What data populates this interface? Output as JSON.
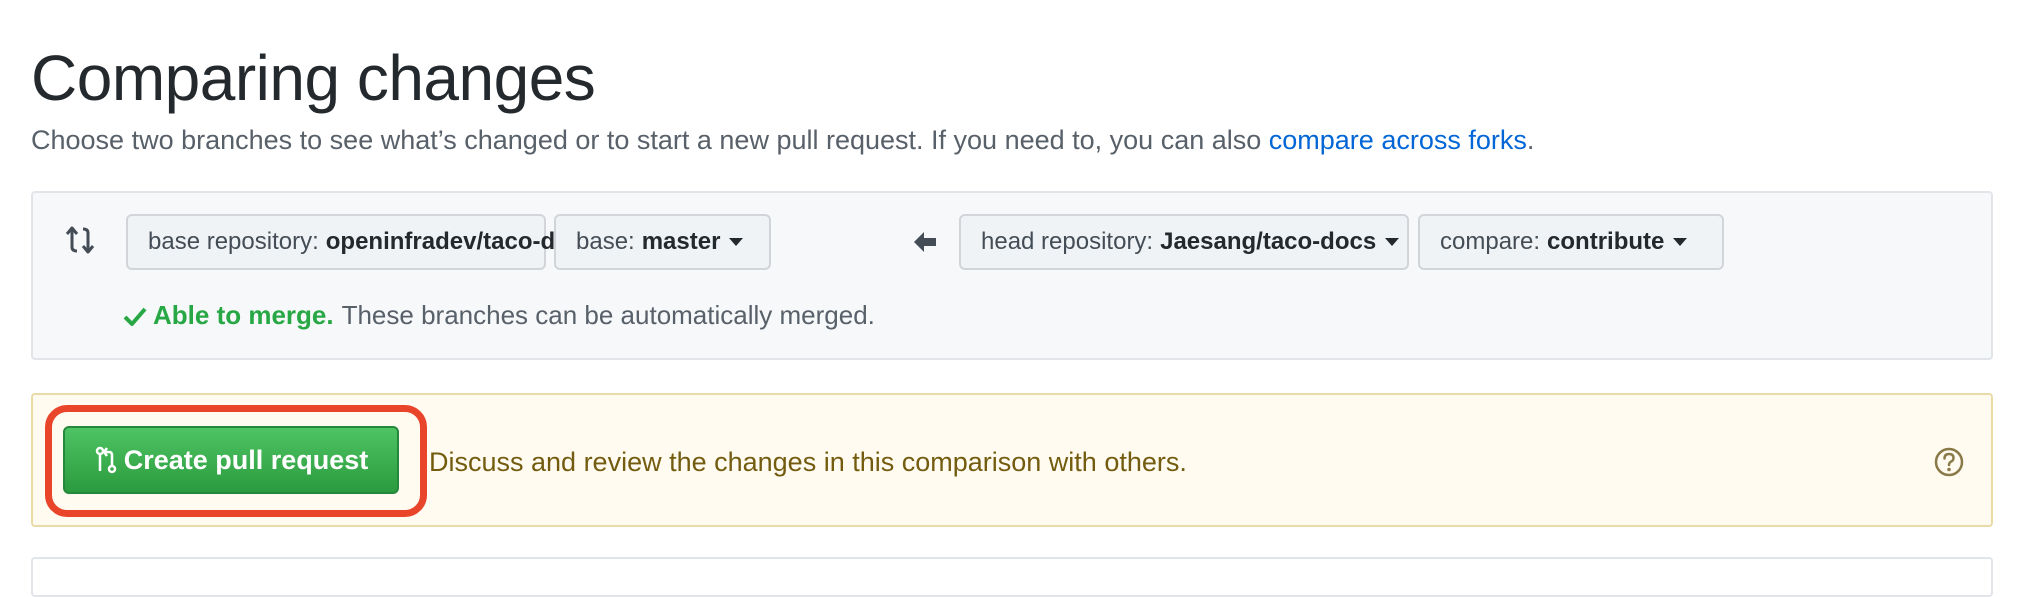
{
  "header": {
    "title": "Comparing changes",
    "subtitle": "Choose two branches to see what’s changed or to start a new pull request. If you need to, you can also ",
    "subtitle_link": "compare across forks",
    "subtitle_end": "."
  },
  "range": {
    "base_repo": {
      "label": "base repository:",
      "value": "openinfradev/taco-docs"
    },
    "base": {
      "label": "base:",
      "value": "master"
    },
    "head_repo": {
      "label": "head repository:",
      "value": "Jaesang/taco-docs"
    },
    "compare": {
      "label": "compare:",
      "value": "contribute"
    },
    "merge_status": "Able to merge.",
    "merge_message": "These branches can be automatically merged."
  },
  "pr_flash": {
    "button_label": "Create pull request",
    "message": "Discuss and review the changes in this comparison with others."
  },
  "icons": {
    "compare": "compare-arrows-icon",
    "arrow": "arrow-left-icon",
    "check": "check-icon",
    "pull_request": "git-pull-request-icon",
    "help": "question-circle-icon"
  },
  "colors": {
    "link": "#0366d6",
    "success": "#28a745",
    "button_green": "#2ea44f",
    "highlight": "#e8452b",
    "flash_bg": "#fffbf0"
  }
}
